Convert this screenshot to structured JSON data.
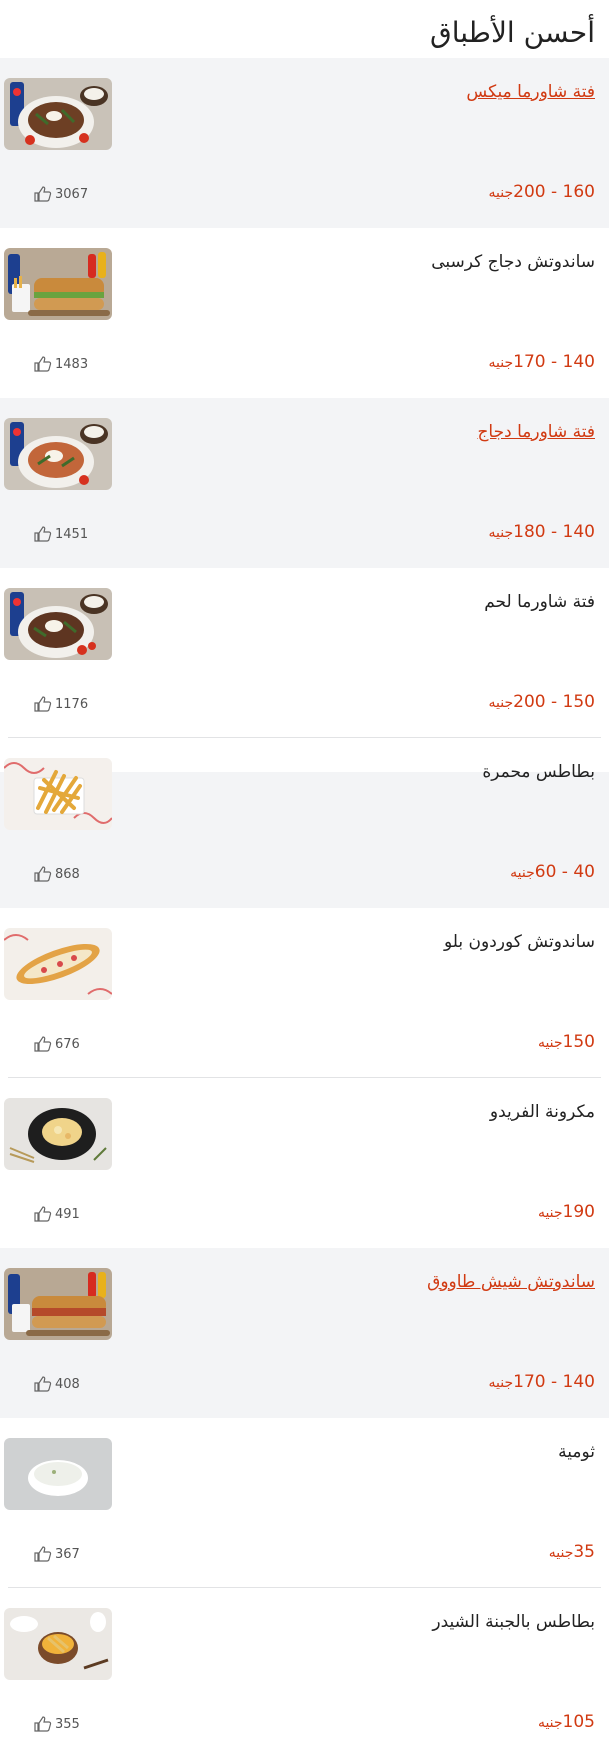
{
  "page": {
    "title": "أحسن الأطباق"
  },
  "colors": {
    "accent": "#d13a12",
    "highlight_bg": "#f3f4f6",
    "text": "#222222"
  },
  "items": [
    {
      "name": "فتة شاورما ميكس",
      "price": "160 - 200",
      "currency": "جنيه",
      "likes": "3067"
    },
    {
      "name": "ساندوتش دجاج كرسبى",
      "price": "140 - 170",
      "currency": "جنيه",
      "likes": "1483"
    },
    {
      "name": "فتة شاورما دجاج",
      "price": "140 - 180",
      "currency": "جنيه",
      "likes": "1451"
    },
    {
      "name": "فتة شاورما لحم",
      "price": "150 - 200",
      "currency": "جنيه",
      "likes": "1176"
    },
    {
      "name": "بطاطس محمرة",
      "price": "40 - 60",
      "currency": "جنيه",
      "likes": "868"
    },
    {
      "name": "ساندوتش كوردون بلو",
      "price": "150",
      "currency": "جنيه",
      "likes": "676"
    },
    {
      "name": "مكرونة الفريدو",
      "price": "190",
      "currency": "جنيه",
      "likes": "491"
    },
    {
      "name": "ساندوتش شيش طاووق",
      "price": "140 - 170",
      "currency": "جنيه",
      "likes": "408"
    },
    {
      "name": "ثومية",
      "price": "35",
      "currency": "جنيه",
      "likes": "367"
    },
    {
      "name": "بطاطس بالجبنة الشيدر",
      "price": "105",
      "currency": "جنيه",
      "likes": "355"
    }
  ]
}
